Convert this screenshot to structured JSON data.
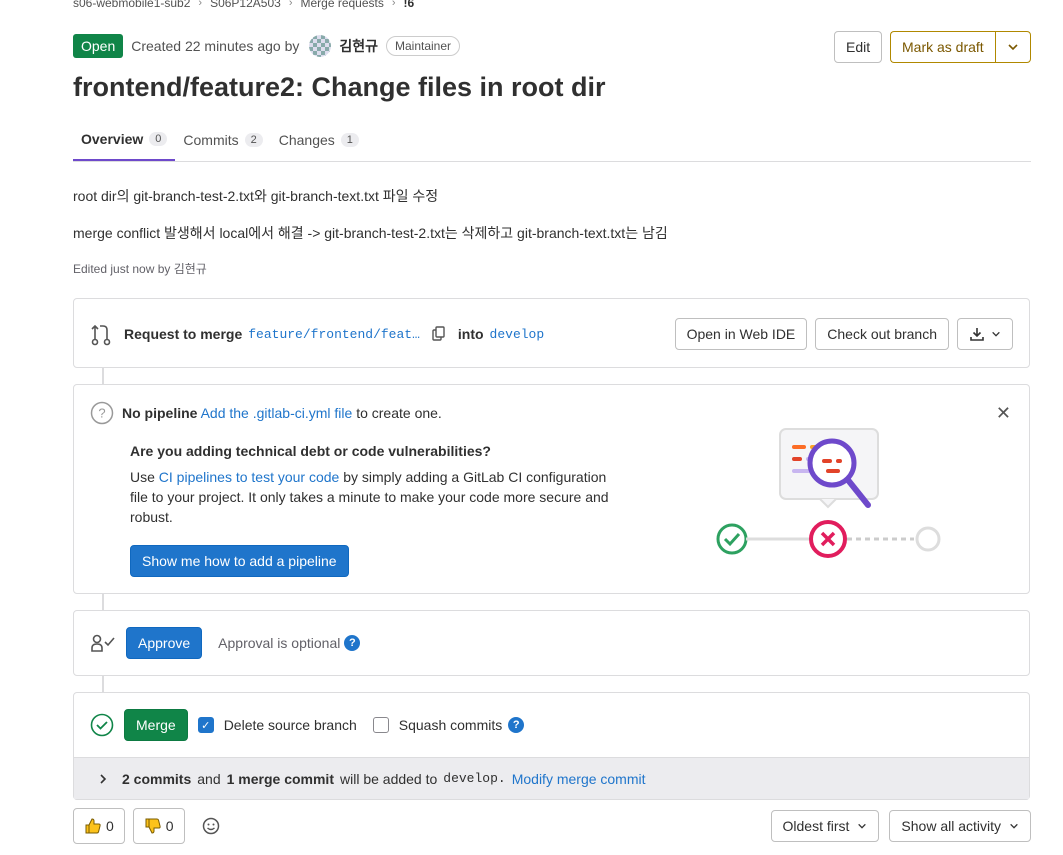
{
  "breadcrumb": [
    "s06-webmobile1-sub2",
    "S06P12A503",
    "Merge requests",
    "!6"
  ],
  "header": {
    "status": "Open",
    "created": "Created 22 minutes ago by",
    "author": "김현규",
    "role": "Maintainer",
    "edit_label": "Edit",
    "draft_label": "Mark as draft"
  },
  "title": "frontend/feature2: Change files in root dir",
  "tabs": [
    {
      "label": "Overview",
      "count": "0"
    },
    {
      "label": "Commits",
      "count": "2"
    },
    {
      "label": "Changes",
      "count": "1"
    }
  ],
  "description": {
    "line1": "root dir의 git-branch-test-2.txt와 git-branch-text.txt 파일 수정",
    "line2": "merge conflict 발생해서 local에서 해결 -> git-branch-test-2.txt는 삭제하고 git-branch-text.txt는 남김",
    "edited": "Edited just now by 김현규"
  },
  "merge_request": {
    "request_label": "Request to merge",
    "source_branch": "feature/frontend/feat…",
    "into_label": "into",
    "target_branch": "develop",
    "web_ide": "Open in Web IDE",
    "checkout": "Check out branch"
  },
  "pipeline": {
    "no_pipeline": "No pipeline",
    "add_link": "Add the .gitlab-ci.yml file",
    "add_suffix": "to create one.",
    "question": "Are you adding technical debt or code vulnerabilities?",
    "text_pre": "Use",
    "text_link": "CI pipelines to test your code",
    "text_post": "by simply adding a GitLab CI configuration file to your project. It only takes a minute to make your code more secure and robust.",
    "button": "Show me how to add a pipeline"
  },
  "approval": {
    "button": "Approve",
    "optional": "Approval is optional"
  },
  "merge": {
    "button": "Merge",
    "delete_branch": "Delete source branch",
    "squash": "Squash commits",
    "commits_bold": "2 commits",
    "and": "and",
    "merge_commit_bold": "1 merge commit",
    "will_be_added": "will be added to",
    "target": "develop.",
    "modify": "Modify merge commit"
  },
  "footer": {
    "thumbs_up": "0",
    "thumbs_down": "0",
    "sort": "Oldest first",
    "filter": "Show all activity"
  },
  "colors": {
    "open": "#108548",
    "primary": "#1f75cb",
    "draft": "#b08800",
    "tab_active": "#6e49cb"
  }
}
